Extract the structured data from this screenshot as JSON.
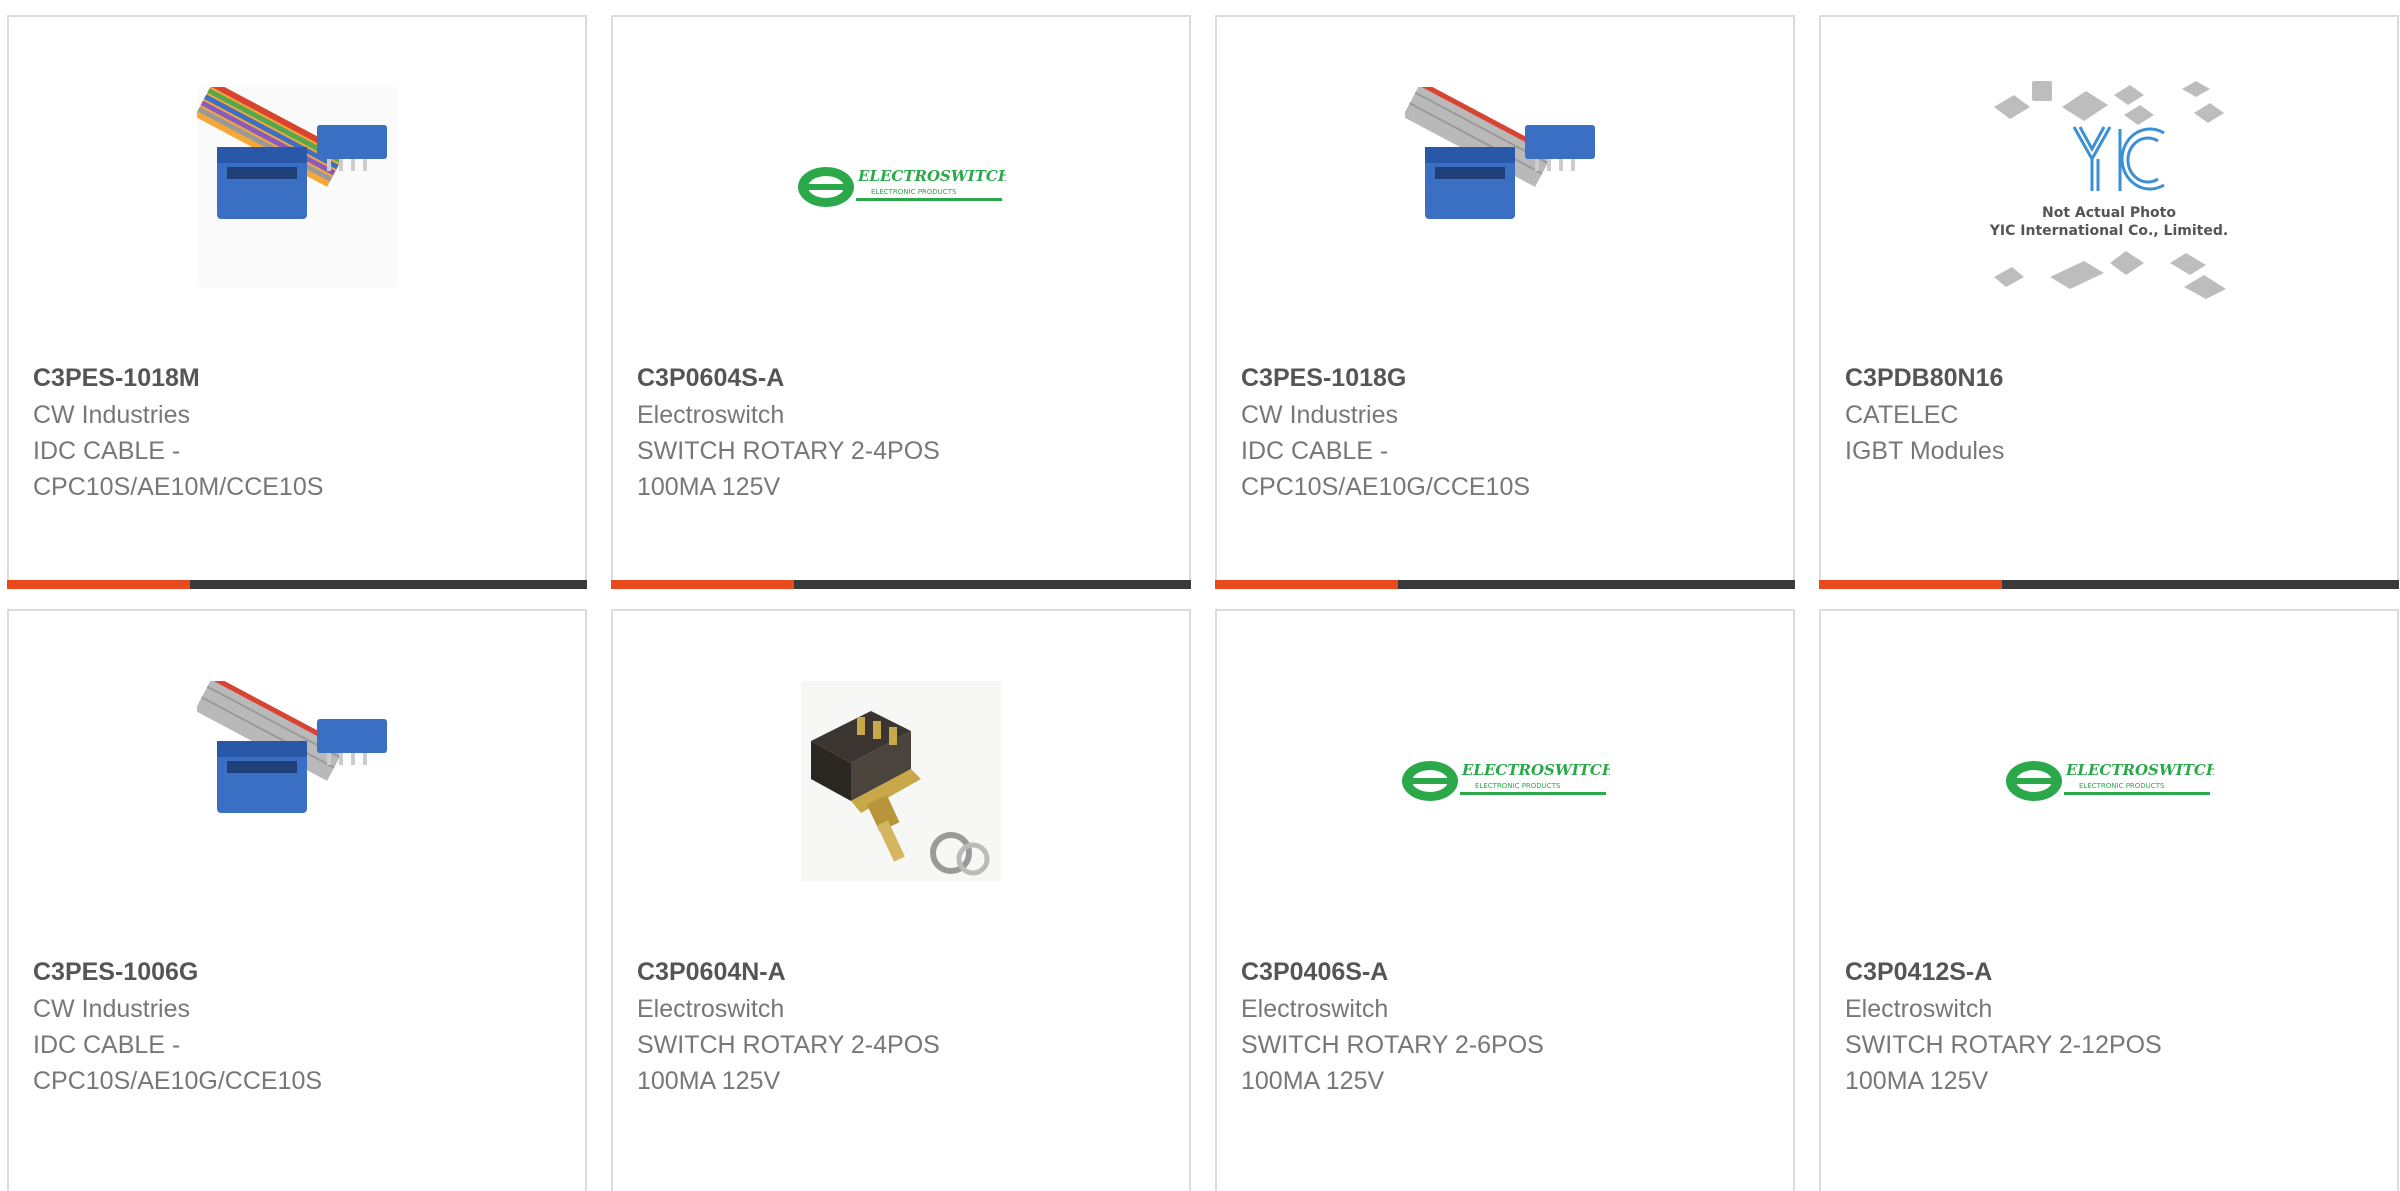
{
  "colors": {
    "accent": "#e84a1b",
    "bar": "#3a3a3a",
    "idc_blue": "#3a6fc4",
    "electroswitch_green": "#2aa84a"
  },
  "products": [
    {
      "part": "C3PES-1018M",
      "manufacturer": "CW Industries",
      "description": "IDC CABLE - CPC10S/AE10M/CCE10S",
      "image": "idc-cable-rainbow"
    },
    {
      "part": "C3P0604S-A",
      "manufacturer": "Electroswitch",
      "description": "SWITCH ROTARY 2-4POS 100MA 125V",
      "image": "electroswitch-logo"
    },
    {
      "part": "C3PES-1018G",
      "manufacturer": "CW Industries",
      "description": "IDC CABLE - CPC10S/AE10G/CCE10S",
      "image": "idc-cable-gray"
    },
    {
      "part": "C3PDB80N16",
      "manufacturer": "CATELEC",
      "description": "IGBT Modules",
      "image": "yic-placeholder"
    },
    {
      "part": "C3PES-1006G",
      "manufacturer": "CW Industries",
      "description": "IDC CABLE - CPC10S/AE10G/CCE10S",
      "image": "idc-cable-gray"
    },
    {
      "part": "C3P0604N-A",
      "manufacturer": "Electroswitch",
      "description": "SWITCH ROTARY 2-4POS 100MA 125V",
      "image": "rotary-switch-photo"
    },
    {
      "part": "C3P0406S-A",
      "manufacturer": "Electroswitch",
      "description": "SWITCH ROTARY 2-6POS 100MA 125V",
      "image": "electroswitch-logo"
    },
    {
      "part": "C3P0412S-A",
      "manufacturer": "Electroswitch",
      "description": "SWITCH ROTARY 2-12POS 100MA 125V",
      "image": "electroswitch-logo"
    }
  ],
  "logos": {
    "electroswitch": {
      "name": "ELECTROSWITCH",
      "tagline": "ELECTRONIC PRODUCTS"
    },
    "yic": {
      "mark": "YIC",
      "line1": "Not Actual Photo",
      "line2": "YIC International Co., Limited."
    }
  }
}
